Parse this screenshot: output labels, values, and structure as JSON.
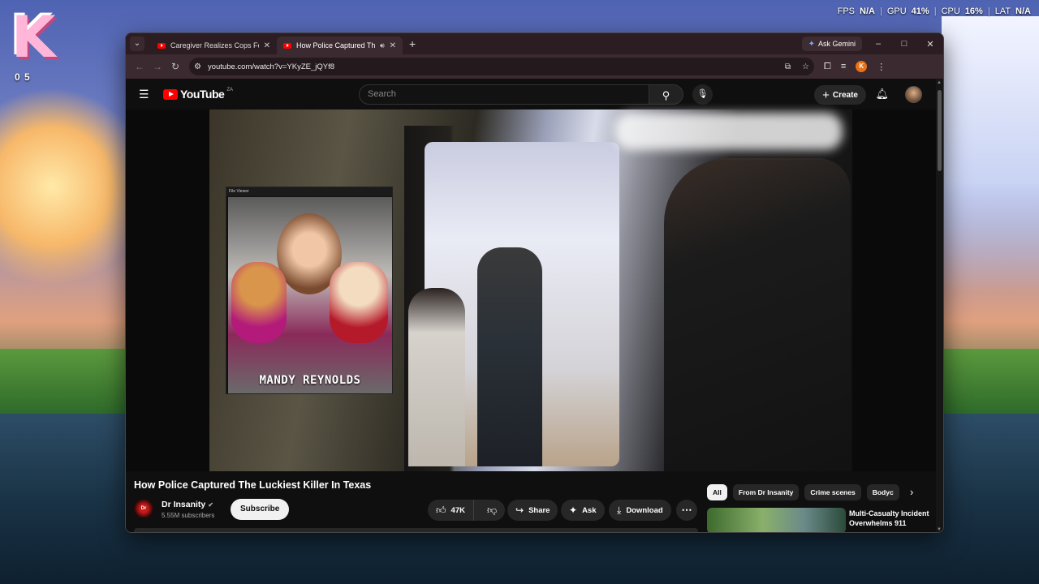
{
  "desktop": {
    "logo_letter": "K",
    "counter": "0 5",
    "hud": {
      "fps_label": "FPS",
      "fps_value": "N/A",
      "gpu_label": "GPU",
      "gpu_value": "41%",
      "cpu_label": "CPU",
      "cpu_value": "16%",
      "lat_label": "LAT",
      "lat_value": "N/A",
      "separator": "|"
    }
  },
  "browser": {
    "tabs": [
      {
        "title": "Caregiver Realizes Cops Found",
        "active": false
      },
      {
        "title": "How Police Captured The Lu",
        "active": true
      }
    ],
    "new_tab": "+",
    "ask_gemini": "Ask Gemini",
    "url": "youtube.com/watch?v=YKyZE_jQYf8",
    "profile_initial": "K",
    "window_controls": {
      "minimize": "–",
      "maximize": "□",
      "close": "✕"
    }
  },
  "youtube": {
    "logo_text": "YouTube",
    "country_code": "ZA",
    "search_placeholder": "Search",
    "create_label": "Create",
    "video": {
      "file_viewer_title": "File Viewer",
      "overlay_caption": "MANDY REYNOLDS"
    },
    "title": "How Police Captured The Luckiest Killer In Texas",
    "channel": {
      "name": "Dr Insanity",
      "subscribers": "5.55M subscribers",
      "avatar_text": "Dr"
    },
    "subscribe_label": "Subscribe",
    "actions": {
      "likes": "47K",
      "share": "Share",
      "ask": "Ask",
      "download": "Download"
    },
    "chips": [
      "All",
      "From Dr Insanity",
      "Crime scenes",
      "Bodyc"
    ],
    "recommendation": {
      "title": "Multi-Casualty Incident Overwhelms 911"
    }
  },
  "colors": {
    "accent": "#ff0000",
    "tab_bar": "#2b1d21",
    "page_bg": "#0f0f0f"
  }
}
